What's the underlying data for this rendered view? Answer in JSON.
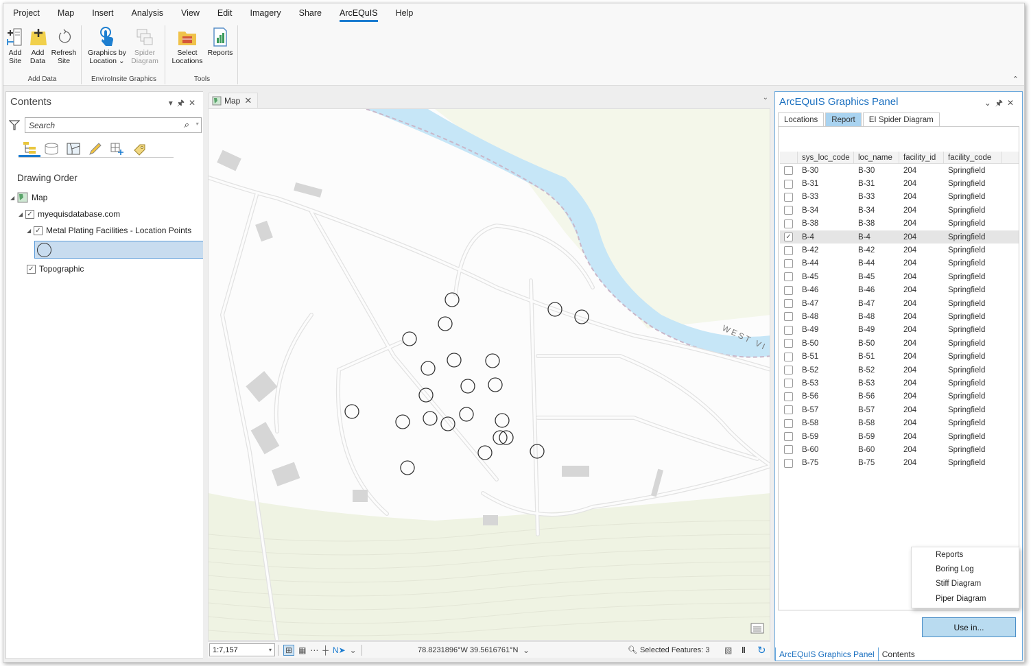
{
  "menu": {
    "items": [
      "Project",
      "Map",
      "Insert",
      "Analysis",
      "View",
      "Edit",
      "Imagery",
      "Share",
      "ArcEQuIS",
      "Help"
    ],
    "active": "ArcEQuIS"
  },
  "ribbon": {
    "groups": [
      {
        "label": "Add Data",
        "buttons": [
          {
            "line1": "Add",
            "line2": "Site",
            "icon": "add-site-icon"
          },
          {
            "line1": "Add",
            "line2": "Data",
            "icon": "add-data-icon"
          },
          {
            "line1": "Refresh",
            "line2": "Site",
            "icon": "refresh-icon"
          }
        ]
      },
      {
        "label": "EnviroInsite Graphics",
        "buttons": [
          {
            "line1": "Graphics by",
            "line2": "Location ⌄",
            "icon": "pointer-hand-icon"
          },
          {
            "line1": "Spider",
            "line2": "Diagram",
            "icon": "spider-diagram-icon",
            "disabled": true
          }
        ]
      },
      {
        "label": "Tools",
        "buttons": [
          {
            "line1": "Select",
            "line2": "Locations",
            "icon": "toolbox-folder-icon"
          },
          {
            "line1": "Reports",
            "line2": "",
            "icon": "report-chart-icon"
          }
        ]
      }
    ]
  },
  "contents": {
    "title": "Contents",
    "search_placeholder": "Search",
    "section_title": "Drawing Order",
    "tree": {
      "map": "Map",
      "database": "myequisdatabase.com",
      "layer": "Metal Plating Facilities - Location Points",
      "basemap": "Topographic"
    }
  },
  "map": {
    "tab_label": "Map",
    "scale": "1:7,157",
    "coordinates": "78.8231896°W 39.5616761°N",
    "selected_features": "Selected Features: 3",
    "road_label": "WEST VI",
    "colors": {
      "water": "#c6e6f7",
      "vegetation": "#eef2e0",
      "road": "#e4e4e4",
      "building": "#d4d4d4"
    }
  },
  "graphics_panel": {
    "title": "ArcEQuIS Graphics Panel",
    "tabs": [
      "Locations",
      "Report",
      "EI Spider Diagram"
    ],
    "active_tab": "Report",
    "columns": [
      "sys_loc_code",
      "loc_name",
      "facility_id",
      "facility_code"
    ],
    "rows": [
      {
        "sys_loc_code": "B-30",
        "loc_name": "B-30",
        "facility_id": "204",
        "facility_code": "Springfield",
        "checked": false
      },
      {
        "sys_loc_code": "B-31",
        "loc_name": "B-31",
        "facility_id": "204",
        "facility_code": "Springfield",
        "checked": false
      },
      {
        "sys_loc_code": "B-33",
        "loc_name": "B-33",
        "facility_id": "204",
        "facility_code": "Springfield",
        "checked": false
      },
      {
        "sys_loc_code": "B-34",
        "loc_name": "B-34",
        "facility_id": "204",
        "facility_code": "Springfield",
        "checked": false
      },
      {
        "sys_loc_code": "B-38",
        "loc_name": "B-38",
        "facility_id": "204",
        "facility_code": "Springfield",
        "checked": false
      },
      {
        "sys_loc_code": "B-4",
        "loc_name": "B-4",
        "facility_id": "204",
        "facility_code": "Springfield",
        "checked": true
      },
      {
        "sys_loc_code": "B-42",
        "loc_name": "B-42",
        "facility_id": "204",
        "facility_code": "Springfield",
        "checked": false
      },
      {
        "sys_loc_code": "B-44",
        "loc_name": "B-44",
        "facility_id": "204",
        "facility_code": "Springfield",
        "checked": false
      },
      {
        "sys_loc_code": "B-45",
        "loc_name": "B-45",
        "facility_id": "204",
        "facility_code": "Springfield",
        "checked": false
      },
      {
        "sys_loc_code": "B-46",
        "loc_name": "B-46",
        "facility_id": "204",
        "facility_code": "Springfield",
        "checked": false
      },
      {
        "sys_loc_code": "B-47",
        "loc_name": "B-47",
        "facility_id": "204",
        "facility_code": "Springfield",
        "checked": false
      },
      {
        "sys_loc_code": "B-48",
        "loc_name": "B-48",
        "facility_id": "204",
        "facility_code": "Springfield",
        "checked": false
      },
      {
        "sys_loc_code": "B-49",
        "loc_name": "B-49",
        "facility_id": "204",
        "facility_code": "Springfield",
        "checked": false
      },
      {
        "sys_loc_code": "B-50",
        "loc_name": "B-50",
        "facility_id": "204",
        "facility_code": "Springfield",
        "checked": false
      },
      {
        "sys_loc_code": "B-51",
        "loc_name": "B-51",
        "facility_id": "204",
        "facility_code": "Springfield",
        "checked": false
      },
      {
        "sys_loc_code": "B-52",
        "loc_name": "B-52",
        "facility_id": "204",
        "facility_code": "Springfield",
        "checked": false
      },
      {
        "sys_loc_code": "B-53",
        "loc_name": "B-53",
        "facility_id": "204",
        "facility_code": "Springfield",
        "checked": false
      },
      {
        "sys_loc_code": "B-56",
        "loc_name": "B-56",
        "facility_id": "204",
        "facility_code": "Springfield",
        "checked": false
      },
      {
        "sys_loc_code": "B-57",
        "loc_name": "B-57",
        "facility_id": "204",
        "facility_code": "Springfield",
        "checked": false
      },
      {
        "sys_loc_code": "B-58",
        "loc_name": "B-58",
        "facility_id": "204",
        "facility_code": "Springfield",
        "checked": false
      },
      {
        "sys_loc_code": "B-59",
        "loc_name": "B-59",
        "facility_id": "204",
        "facility_code": "Springfield",
        "checked": false
      },
      {
        "sys_loc_code": "B-60",
        "loc_name": "B-60",
        "facility_id": "204",
        "facility_code": "Springfield",
        "checked": false
      },
      {
        "sys_loc_code": "B-75",
        "loc_name": "B-75",
        "facility_id": "204",
        "facility_code": "Springfield",
        "checked": false
      }
    ],
    "context_menu": [
      "Reports",
      "Boring Log",
      "Stiff Diagram",
      "Piper Diagram"
    ],
    "use_in_label": "Use in...",
    "bottom_tabs": [
      "ArcEQuIS Graphics Panel",
      "Contents"
    ],
    "active_bottom_tab": "ArcEQuIS Graphics Panel"
  }
}
